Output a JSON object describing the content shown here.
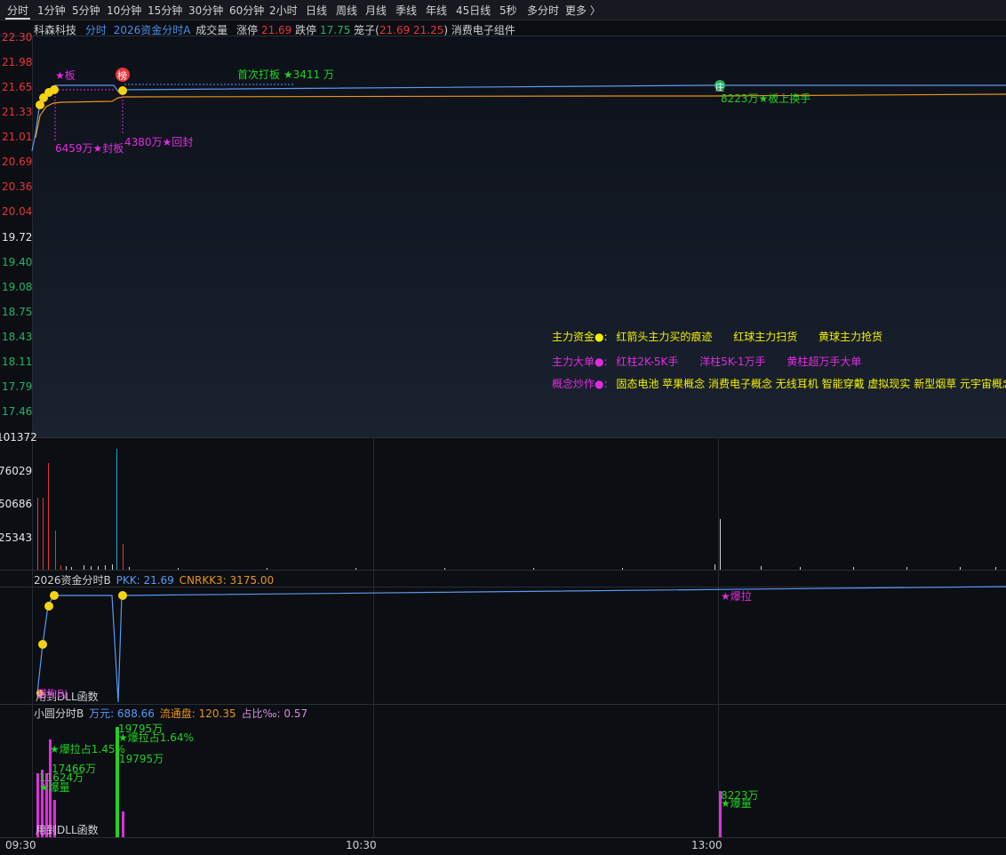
{
  "tabs": [
    "分时",
    "1分钟",
    "5分钟",
    "10分钟",
    "15分钟",
    "30分钟",
    "60分钟",
    "2小时",
    "日线",
    "周线",
    "月线",
    "季线",
    "年线",
    "45日线",
    "5秒",
    "多分时",
    "更多 〉"
  ],
  "info_bar": {
    "stock_name": "科森科技",
    "mode": "分时",
    "indicator": "2026资金分时A",
    "volume_label": "成交量",
    "limit_up_label": "涨停",
    "limit_up_value": "21.69",
    "limit_down_label": "跌停",
    "limit_down_value": "17.75",
    "cage_label": "笼子(",
    "cage_hi": "21.69",
    "cage_lo": "21.25",
    "cage_close": ")",
    "sector": "消费电子组件"
  },
  "price_axis": [
    "22.30",
    "21.98",
    "21.65",
    "21.33",
    "21.01",
    "20.69",
    "20.36",
    "20.04",
    "19.72",
    "19.40",
    "19.08",
    "18.75",
    "18.43",
    "18.11",
    "17.79",
    "17.46"
  ],
  "volume_axis": [
    "101372",
    "76029",
    "50686",
    "25343"
  ],
  "time_axis": [
    "09:30",
    "10:30",
    "13:00"
  ],
  "main_annotations": {
    "star_ban": "★板",
    "bang_icon": "榜",
    "first_board": "首次打板 ★3411 万",
    "seal": "6459万★封板",
    "reseal": "4380万★回封",
    "chi_icon": "庄",
    "turnover": "8223万★板上换手"
  },
  "legend": {
    "row1_title": "主力资金●:",
    "row1_items": [
      "红箭头主力买的痕迹",
      "红球主力扫货",
      "黄球主力抢货"
    ],
    "row2_title": "主力大单●:",
    "row2_items": [
      "红柱2K-5K手",
      "洋柱5K-1万手",
      "黄柱超万手大单"
    ],
    "row3_title": "概念炒作●:",
    "row3_text": "固态电池 苹果概念 消费电子概念 无线耳机 智能穿戴 虚拟现实 新型烟草 元宇宙概念"
  },
  "panel_b": {
    "title": "2026资金分时B",
    "pkk": "PKK: 21.69",
    "cnrkk": "CNRKK3: 3175.00",
    "explode": "★爆拉",
    "dll_prefix": "用到",
    "dll": "DLL函数",
    "dll_overlay": "猎狗DJ"
  },
  "panel_c": {
    "title": "小圆分时B",
    "wanyuan": "万元: 688.66",
    "float": "流通盘: 120.35",
    "ratio": "占比‰: 0.57",
    "a1": "★爆拉占1.45%",
    "a2": "17466万",
    "a3": "11624万",
    "a4": "★爆量",
    "a5": "19795万",
    "a6": "★爆拉占1.64%",
    "a7": "19795万",
    "a8": "8223万",
    "a9": "★爆量",
    "dll_prefix": "用到",
    "dll": "DLL函数"
  },
  "colors": {
    "red": "#e8343a",
    "green": "#22b46a",
    "magenta": "#e02ce0",
    "yellow": "#f4f200",
    "price_line": "#5a9af0",
    "avg_line": "#e89418"
  }
}
